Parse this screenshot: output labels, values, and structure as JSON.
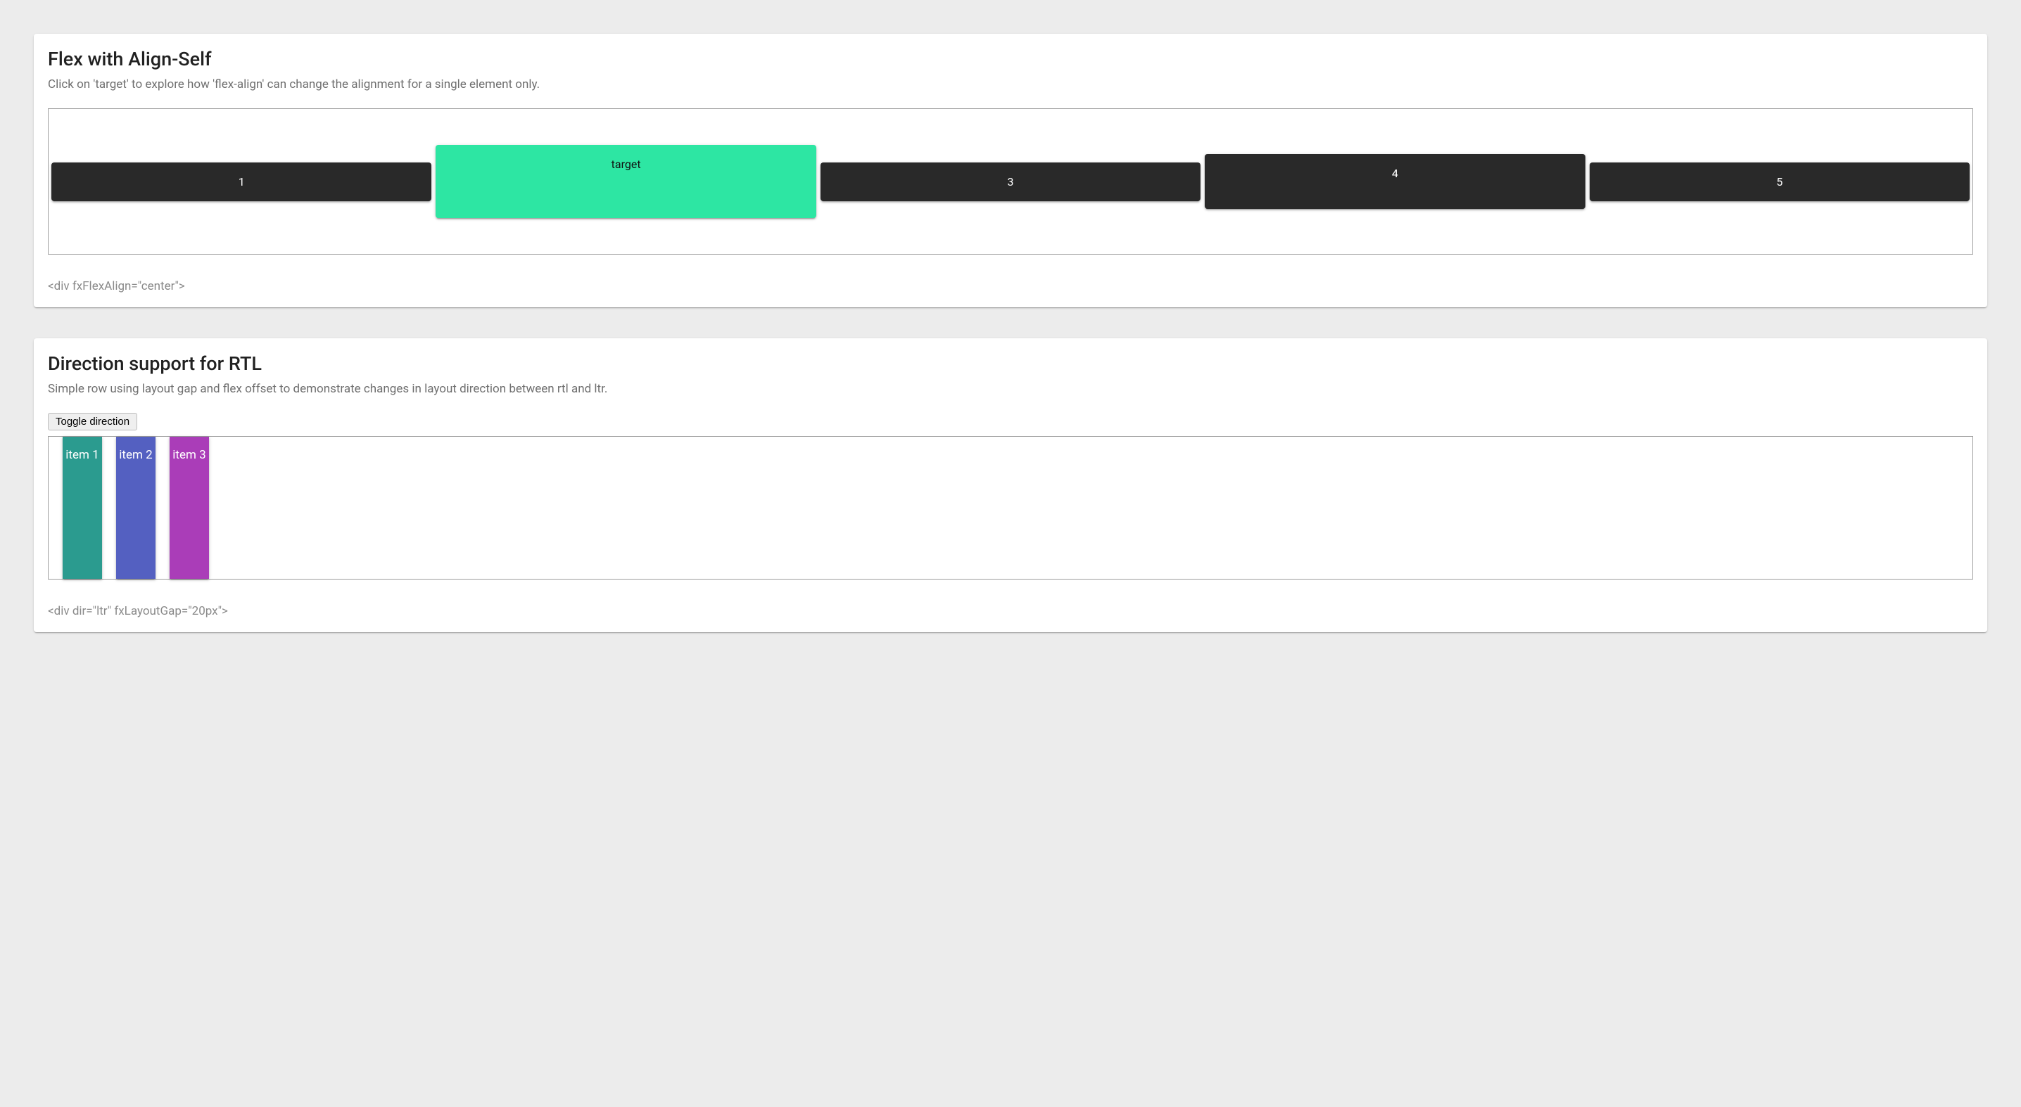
{
  "alignSelf": {
    "title": "Flex with Align-Self",
    "subtitle": "Click on 'target' to explore how 'flex-align' can change the alignment for a single element only.",
    "blocks": {
      "one": "1",
      "target": "target",
      "three": "3",
      "four": "4",
      "five": "5"
    },
    "hint": "<div fxFlexAlign=\"center\">"
  },
  "rtl": {
    "title": "Direction support for RTL",
    "subtitle": "Simple row using layout gap and flex offset to demonstrate changes in layout direction between rtl and ltr.",
    "toggleLabel": "Toggle direction",
    "items": {
      "one": "item 1",
      "two": "item 2",
      "three": "item 3"
    },
    "hint": "<div dir=\"ltr\" fxLayoutGap=\"20px\">"
  }
}
